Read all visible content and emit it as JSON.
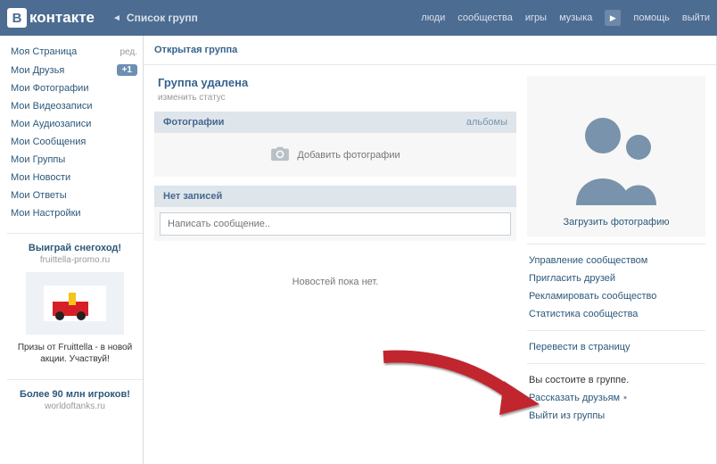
{
  "header": {
    "logo_letter": "В",
    "logo_text": "контакте",
    "breadcrumb": "Список групп",
    "nav": {
      "people": "люди",
      "communities": "сообщества",
      "games": "игры",
      "music": "музыка",
      "help": "помощь",
      "logout": "выйти"
    }
  },
  "sidebar": {
    "items": [
      {
        "label": "Моя Страница",
        "badge_type": "edit",
        "badge": "ред."
      },
      {
        "label": "Мои Друзья",
        "badge_type": "count",
        "badge": "+1"
      },
      {
        "label": "Мои Фотографии"
      },
      {
        "label": "Мои Видеозаписи"
      },
      {
        "label": "Мои Аудиозаписи"
      },
      {
        "label": "Мои Сообщения"
      },
      {
        "label": "Мои Группы"
      },
      {
        "label": "Мои Новости"
      },
      {
        "label": "Мои Ответы"
      },
      {
        "label": "Мои Настройки"
      }
    ],
    "ads": [
      {
        "title": "Выиграй снегоход!",
        "domain": "fruittella-promo.ru",
        "desc": "Призы от Fruittella - в новой акции. Участвуй!"
      },
      {
        "title": "Более 90 млн игроков!",
        "domain": "worldoftanks.ru",
        "desc": ""
      }
    ]
  },
  "content": {
    "page_title": "Открытая группа",
    "group_name": "Группа удалена",
    "status_placeholder": "изменить статус",
    "photos_header": "Фотографии",
    "albums_link": "альбомы",
    "add_photos": "Добавить фотографии",
    "no_posts_header": "Нет записей",
    "post_placeholder": "Написать сообщение..",
    "no_news": "Новостей пока нет."
  },
  "right": {
    "upload_photo": "Загрузить фотографию",
    "admin_links": [
      "Управление сообществом",
      "Пригласить друзей",
      "Рекламировать сообщество",
      "Статистика сообщества"
    ],
    "convert_link": "Перевести в страницу",
    "member_text": "Вы состоите в группе.",
    "tell_friends": "Рассказать друзьям",
    "leave_group": "Выйти из группы"
  }
}
